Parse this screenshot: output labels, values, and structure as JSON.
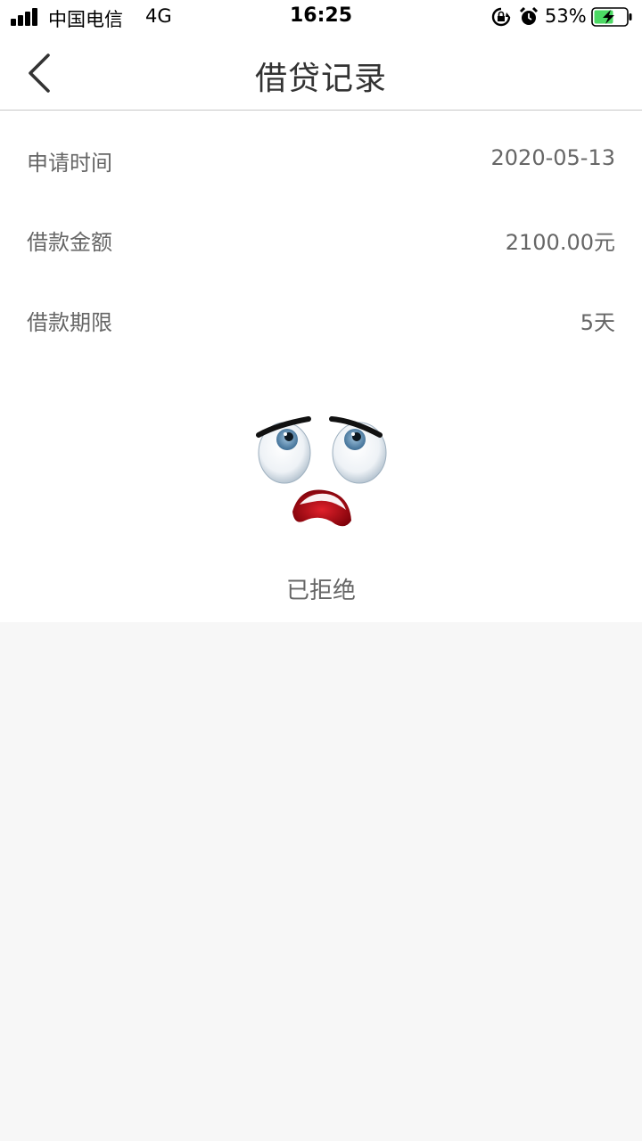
{
  "status_bar": {
    "carrier": "中国电信",
    "network": "4G",
    "time": "16:25",
    "battery": "53%"
  },
  "header": {
    "title": "借贷记录",
    "back_icon": "chevron-left-icon"
  },
  "details": [
    {
      "label": "申请时间",
      "value": "2020-05-13"
    },
    {
      "label": "借款金额",
      "value": "2100.00元"
    },
    {
      "label": "借款期限",
      "value": "5天"
    }
  ],
  "result": {
    "icon": "sad-face-icon",
    "status": "已拒绝"
  },
  "colors": {
    "background": "#f7f7f7",
    "card": "#ffffff",
    "text": "#666666",
    "title": "#333333",
    "battery_green": "#4cd964"
  }
}
